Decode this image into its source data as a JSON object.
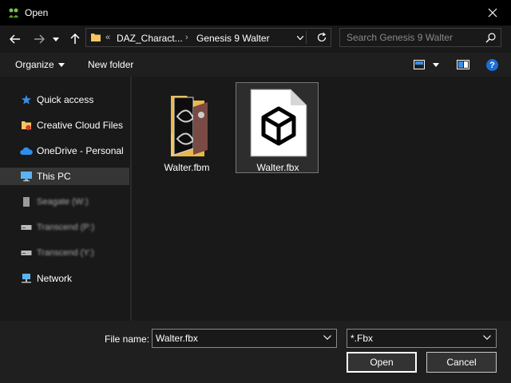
{
  "window": {
    "title": "Open"
  },
  "nav": {
    "breadcrumb_overflow": "«",
    "crumbs": [
      "DAZ_Charact...",
      "Genesis 9 Walter"
    ],
    "separator": "›"
  },
  "search": {
    "placeholder": "Search Genesis 9 Walter"
  },
  "toolbar": {
    "organize_label": "Organize",
    "new_folder_label": "New folder",
    "help_label": "?"
  },
  "sidebar": {
    "items": [
      {
        "label": "Quick access",
        "icon": "star-icon"
      },
      {
        "label": "Creative Cloud Files",
        "icon": "creative-cloud-folder-icon"
      },
      {
        "label": "OneDrive - Personal",
        "icon": "cloud-icon"
      },
      {
        "label": "This PC",
        "icon": "monitor-icon",
        "selected": true
      },
      {
        "label": "Seagate (W:)",
        "icon": "drive-icon",
        "blurred": true
      },
      {
        "label": "Transcend (P:)",
        "icon": "drive-icon",
        "blurred": true
      },
      {
        "label": "Transcend (Y:)",
        "icon": "drive-icon",
        "blurred": true
      },
      {
        "label": "Network",
        "icon": "network-icon"
      }
    ]
  },
  "files": [
    {
      "name": "Walter.fbm",
      "type": "folder"
    },
    {
      "name": "Walter.fbx",
      "type": "fbx",
      "selected": true
    }
  ],
  "footer": {
    "filename_label": "File name:",
    "filename_value": "Walter.fbx",
    "filetype_value": "*.Fbx",
    "open_label": "Open",
    "cancel_label": "Cancel"
  },
  "colors": {
    "accent_blue": "#3a8ee6",
    "folder_yellow": "#f0c860",
    "help_blue": "#1a6fd6"
  }
}
